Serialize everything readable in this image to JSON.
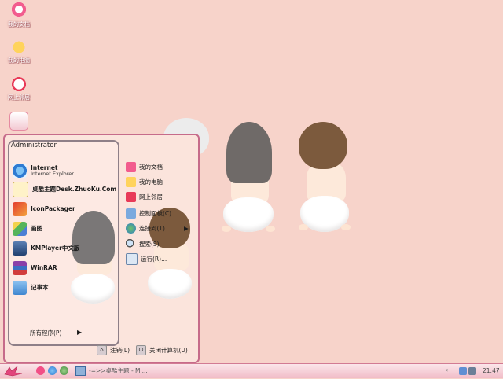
{
  "desktop": {
    "icons": [
      {
        "label": "我的文档",
        "icon": "my-documents-icon"
      },
      {
        "label": "我的电脑",
        "icon": "my-computer-icon"
      },
      {
        "label": "网上邻居",
        "icon": "network-places-icon"
      },
      {
        "label": "",
        "icon": "recycle-bin-icon"
      }
    ]
  },
  "start_menu": {
    "user_name": "Administrator",
    "programs": [
      {
        "name": "Internet",
        "sub": "Internet Explorer",
        "icon": "internet-explorer-icon"
      },
      {
        "name": "桌酷主题Desk.ZhuoKu.Com",
        "sub": "",
        "icon": "theme-site-icon"
      },
      {
        "name": "IconPackager",
        "sub": "",
        "icon": "iconpackager-icon"
      },
      {
        "name": "画图",
        "sub": "",
        "icon": "paint-icon"
      },
      {
        "name": "KMPlayer中文版",
        "sub": "",
        "icon": "kmplayer-icon"
      },
      {
        "name": "WinRAR",
        "sub": "",
        "icon": "winrar-icon"
      },
      {
        "name": "记事本",
        "sub": "",
        "icon": "notepad-icon"
      }
    ],
    "all_programs": "所有程序(P)",
    "places": [
      {
        "label": "我的文档",
        "icon": "my-documents-icon"
      },
      {
        "label": "我的电脑",
        "icon": "my-computer-icon"
      },
      {
        "label": "网上邻居",
        "icon": "network-places-icon"
      },
      {
        "label": "控制面板(C)",
        "icon": "control-panel-icon"
      },
      {
        "label": "连接到(T)",
        "icon": "connect-to-icon"
      },
      {
        "label": "搜索(S)",
        "icon": "search-icon"
      },
      {
        "label": "运行(R)...",
        "icon": "run-icon"
      }
    ],
    "logoff": "注销(L)",
    "shutdown": "关闭计算机(U)"
  },
  "taskbar": {
    "task_title": "-=>>桌酷主题 - Mi...",
    "clock": "21:47"
  },
  "colors": {
    "desktop_bg": "#f7d3ca",
    "accent": "#c66b8a"
  }
}
